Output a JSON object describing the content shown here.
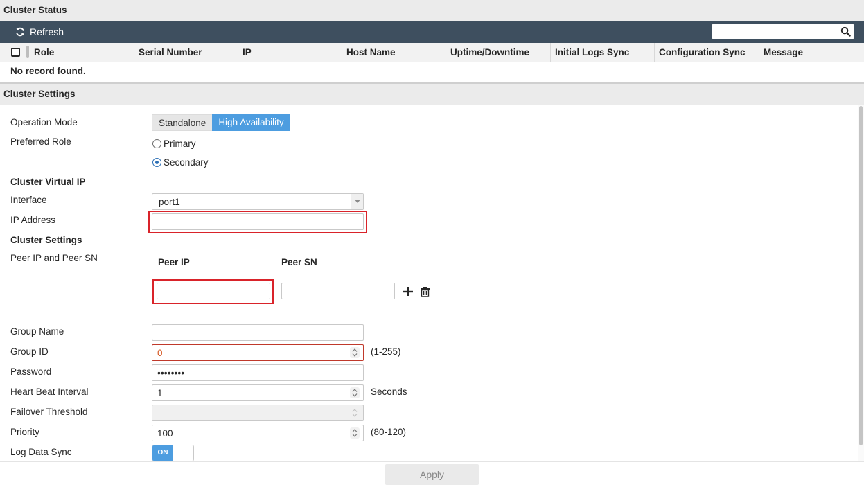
{
  "cluster_status": {
    "title": "Cluster Status",
    "toolbar": {
      "refresh_label": "Refresh",
      "search_value": ""
    },
    "columns": [
      "Role",
      "Serial Number",
      "IP",
      "Host Name",
      "Uptime/Downtime",
      "Initial Logs Sync",
      "Configuration Sync",
      "Message"
    ],
    "empty_text": "No record found."
  },
  "cluster_settings": {
    "title": "Cluster Settings",
    "operation_mode": {
      "label": "Operation Mode",
      "options": [
        "Standalone",
        "High Availability"
      ],
      "selected": "High Availability"
    },
    "preferred_role": {
      "label": "Preferred Role",
      "options": [
        "Primary",
        "Secondary"
      ],
      "selected": "Secondary"
    },
    "cluster_virtual_ip": {
      "heading": "Cluster Virtual IP",
      "interface_label": "Interface",
      "interface_value": "port1",
      "ip_address_label": "IP Address",
      "ip_address_value": ""
    },
    "cluster_settings_heading": "Cluster Settings",
    "peer": {
      "label": "Peer IP and Peer SN",
      "peer_ip_header": "Peer IP",
      "peer_sn_header": "Peer SN",
      "peer_ip_value": "",
      "peer_sn_value": ""
    },
    "group_name": {
      "label": "Group Name",
      "value": ""
    },
    "group_id": {
      "label": "Group ID",
      "value": "0",
      "hint": "(1-255)"
    },
    "password": {
      "label": "Password",
      "value": "••••••••"
    },
    "heartbeat": {
      "label": "Heart Beat Interval",
      "value": "1",
      "unit": "Seconds"
    },
    "failover_threshold": {
      "label": "Failover Threshold",
      "value": ""
    },
    "priority": {
      "label": "Priority",
      "value": "100",
      "hint": "(80-120)"
    },
    "log_data_sync": {
      "label": "Log Data Sync",
      "state": "ON"
    }
  },
  "footer": {
    "apply_label": "Apply"
  },
  "colors": {
    "toolbar": "#3e4f5f",
    "accent": "#4d9de0",
    "error": "#d9232a"
  }
}
